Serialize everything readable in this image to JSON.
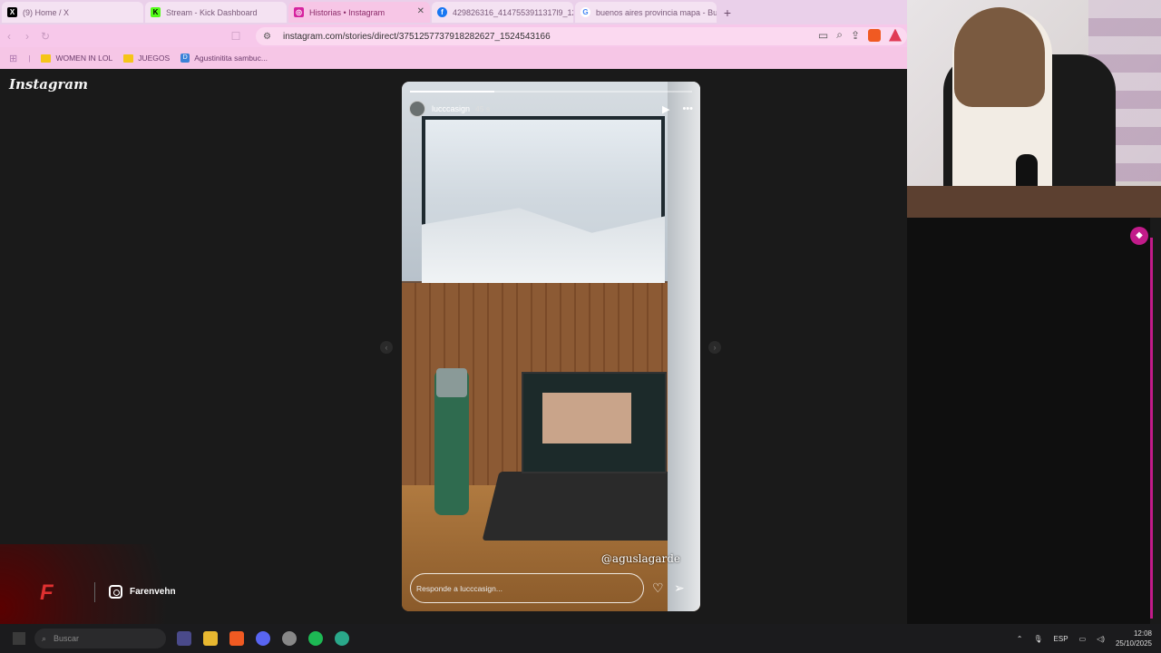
{
  "browser": {
    "tabs": [
      {
        "title": "(9) Home / X",
        "icon": "x-icon",
        "color": "#000000",
        "active": false
      },
      {
        "title": "Stream - Kick Dashboard",
        "icon": "kick-icon",
        "color": "#1a1a1a",
        "active": false
      },
      {
        "title": "Historias • Instagram",
        "icon": "instagram-icon",
        "color": "#d6249f",
        "active": true
      },
      {
        "title": "429826316_4147553911317l9_12...",
        "icon": "facebook-icon",
        "color": "#1877f2",
        "active": false
      },
      {
        "title": "buenos aires provincia mapa - Bus...",
        "icon": "google-icon",
        "color": "#ffffff",
        "active": false
      }
    ],
    "url": "instagram.com/stories/direct/3751257737918282627_1524543166",
    "bookmarks": [
      {
        "label": "WOMEN IN LOL",
        "icon": "folder-icon"
      },
      {
        "label": "JUEGOS",
        "icon": "folder-icon"
      },
      {
        "label": "Agustinitita sambuc...",
        "icon": "doc-icon"
      }
    ]
  },
  "instagram": {
    "logo": "Instagram",
    "story": {
      "username": "lucccasign",
      "time": "45 s",
      "progress": 0.3,
      "mention": "@aguslagarde",
      "reply_placeholder": "Responde a lucccasign..."
    }
  },
  "overlay": {
    "brand_logo": "F",
    "instagram_handle": "Farenvehn"
  },
  "taskbar": {
    "search_placeholder": "Buscar",
    "language": "ESP",
    "time": "12:08",
    "date": "25/10/2025"
  },
  "colors": {
    "accent": "#c21b8a",
    "tabbar": "#ead0ea",
    "addressbar": "#f7c8ea"
  }
}
